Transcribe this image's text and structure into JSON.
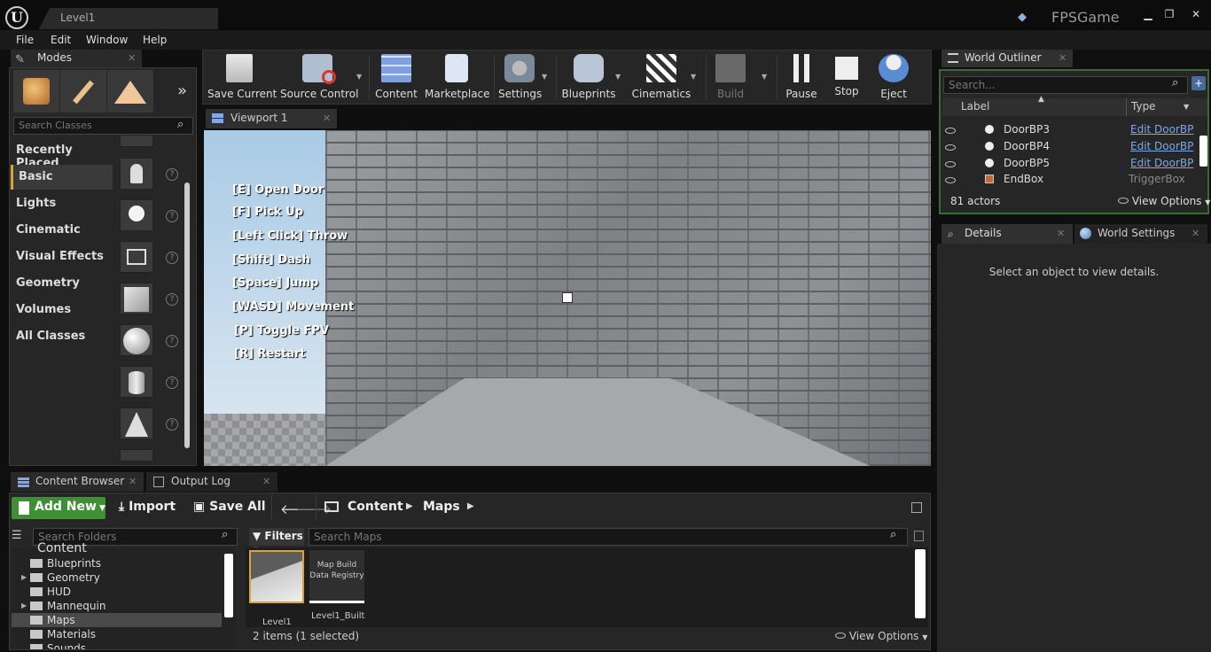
{
  "window": {
    "tab_title": "Level1",
    "project_name": "FPSGame"
  },
  "menu": [
    "File",
    "Edit",
    "Window",
    "Help"
  ],
  "modes": {
    "title": "Modes",
    "search_placeholder": "Search Classes",
    "categories": [
      "Recently Placed",
      "Basic",
      "Lights",
      "Cinematic",
      "Visual Effects",
      "Geometry",
      "Volumes",
      "All Classes"
    ],
    "selected_category": "Basic"
  },
  "toolbar": {
    "buttons": [
      "Save Current",
      "Source Control",
      "Content",
      "Marketplace",
      "Settings",
      "Blueprints",
      "Cinematics",
      "Build",
      "Pause",
      "Stop",
      "Eject"
    ]
  },
  "viewport": {
    "tab": "Viewport 1",
    "hints": [
      "[E] Open Door",
      "[F] Pick Up",
      "[Left Click] Throw",
      "[Shift] Dash",
      "[Space] Jump",
      "[WASD] Movement",
      "[P] Toggle FPV",
      "[R] Restart"
    ]
  },
  "content_browser": {
    "tab": "Content Browser",
    "output_tab": "Output Log",
    "add_new": "Add New",
    "import": "Import",
    "save_all": "Save All",
    "breadcrumb": [
      "Content",
      "Maps"
    ],
    "folder_search_placeholder": "Search Folders",
    "folders": [
      "Content",
      "Blueprints",
      "Geometry",
      "HUD",
      "Mannequin",
      "Maps",
      "Materials",
      "Sounds"
    ],
    "selected_folder": "Maps",
    "filters_label": "Filters",
    "map_search_placeholder": "Search Maps",
    "assets": [
      {
        "name": "Level1",
        "thumb_text": ""
      },
      {
        "name": "Level1_Built",
        "thumb_text": "Map Build Data Registry"
      }
    ],
    "status": "2 items (1 selected)",
    "view_options": "View Options"
  },
  "world_outliner": {
    "title": "World Outliner",
    "search_placeholder": "Search...",
    "col_label": "Label",
    "col_type": "Type",
    "rows": [
      {
        "label": "DoorBP3",
        "type": "Edit DoorBP",
        "is_link": true
      },
      {
        "label": "DoorBP4",
        "type": "Edit DoorBP",
        "is_link": true
      },
      {
        "label": "DoorBP5",
        "type": "Edit DoorBP",
        "is_link": true
      },
      {
        "label": "EndBox",
        "type": "TriggerBox",
        "is_link": false
      }
    ],
    "actor_count": "81 actors",
    "view_options": "View Options"
  },
  "details": {
    "tab": "Details",
    "world_settings_tab": "World Settings",
    "empty_message": "Select an object to view details."
  }
}
